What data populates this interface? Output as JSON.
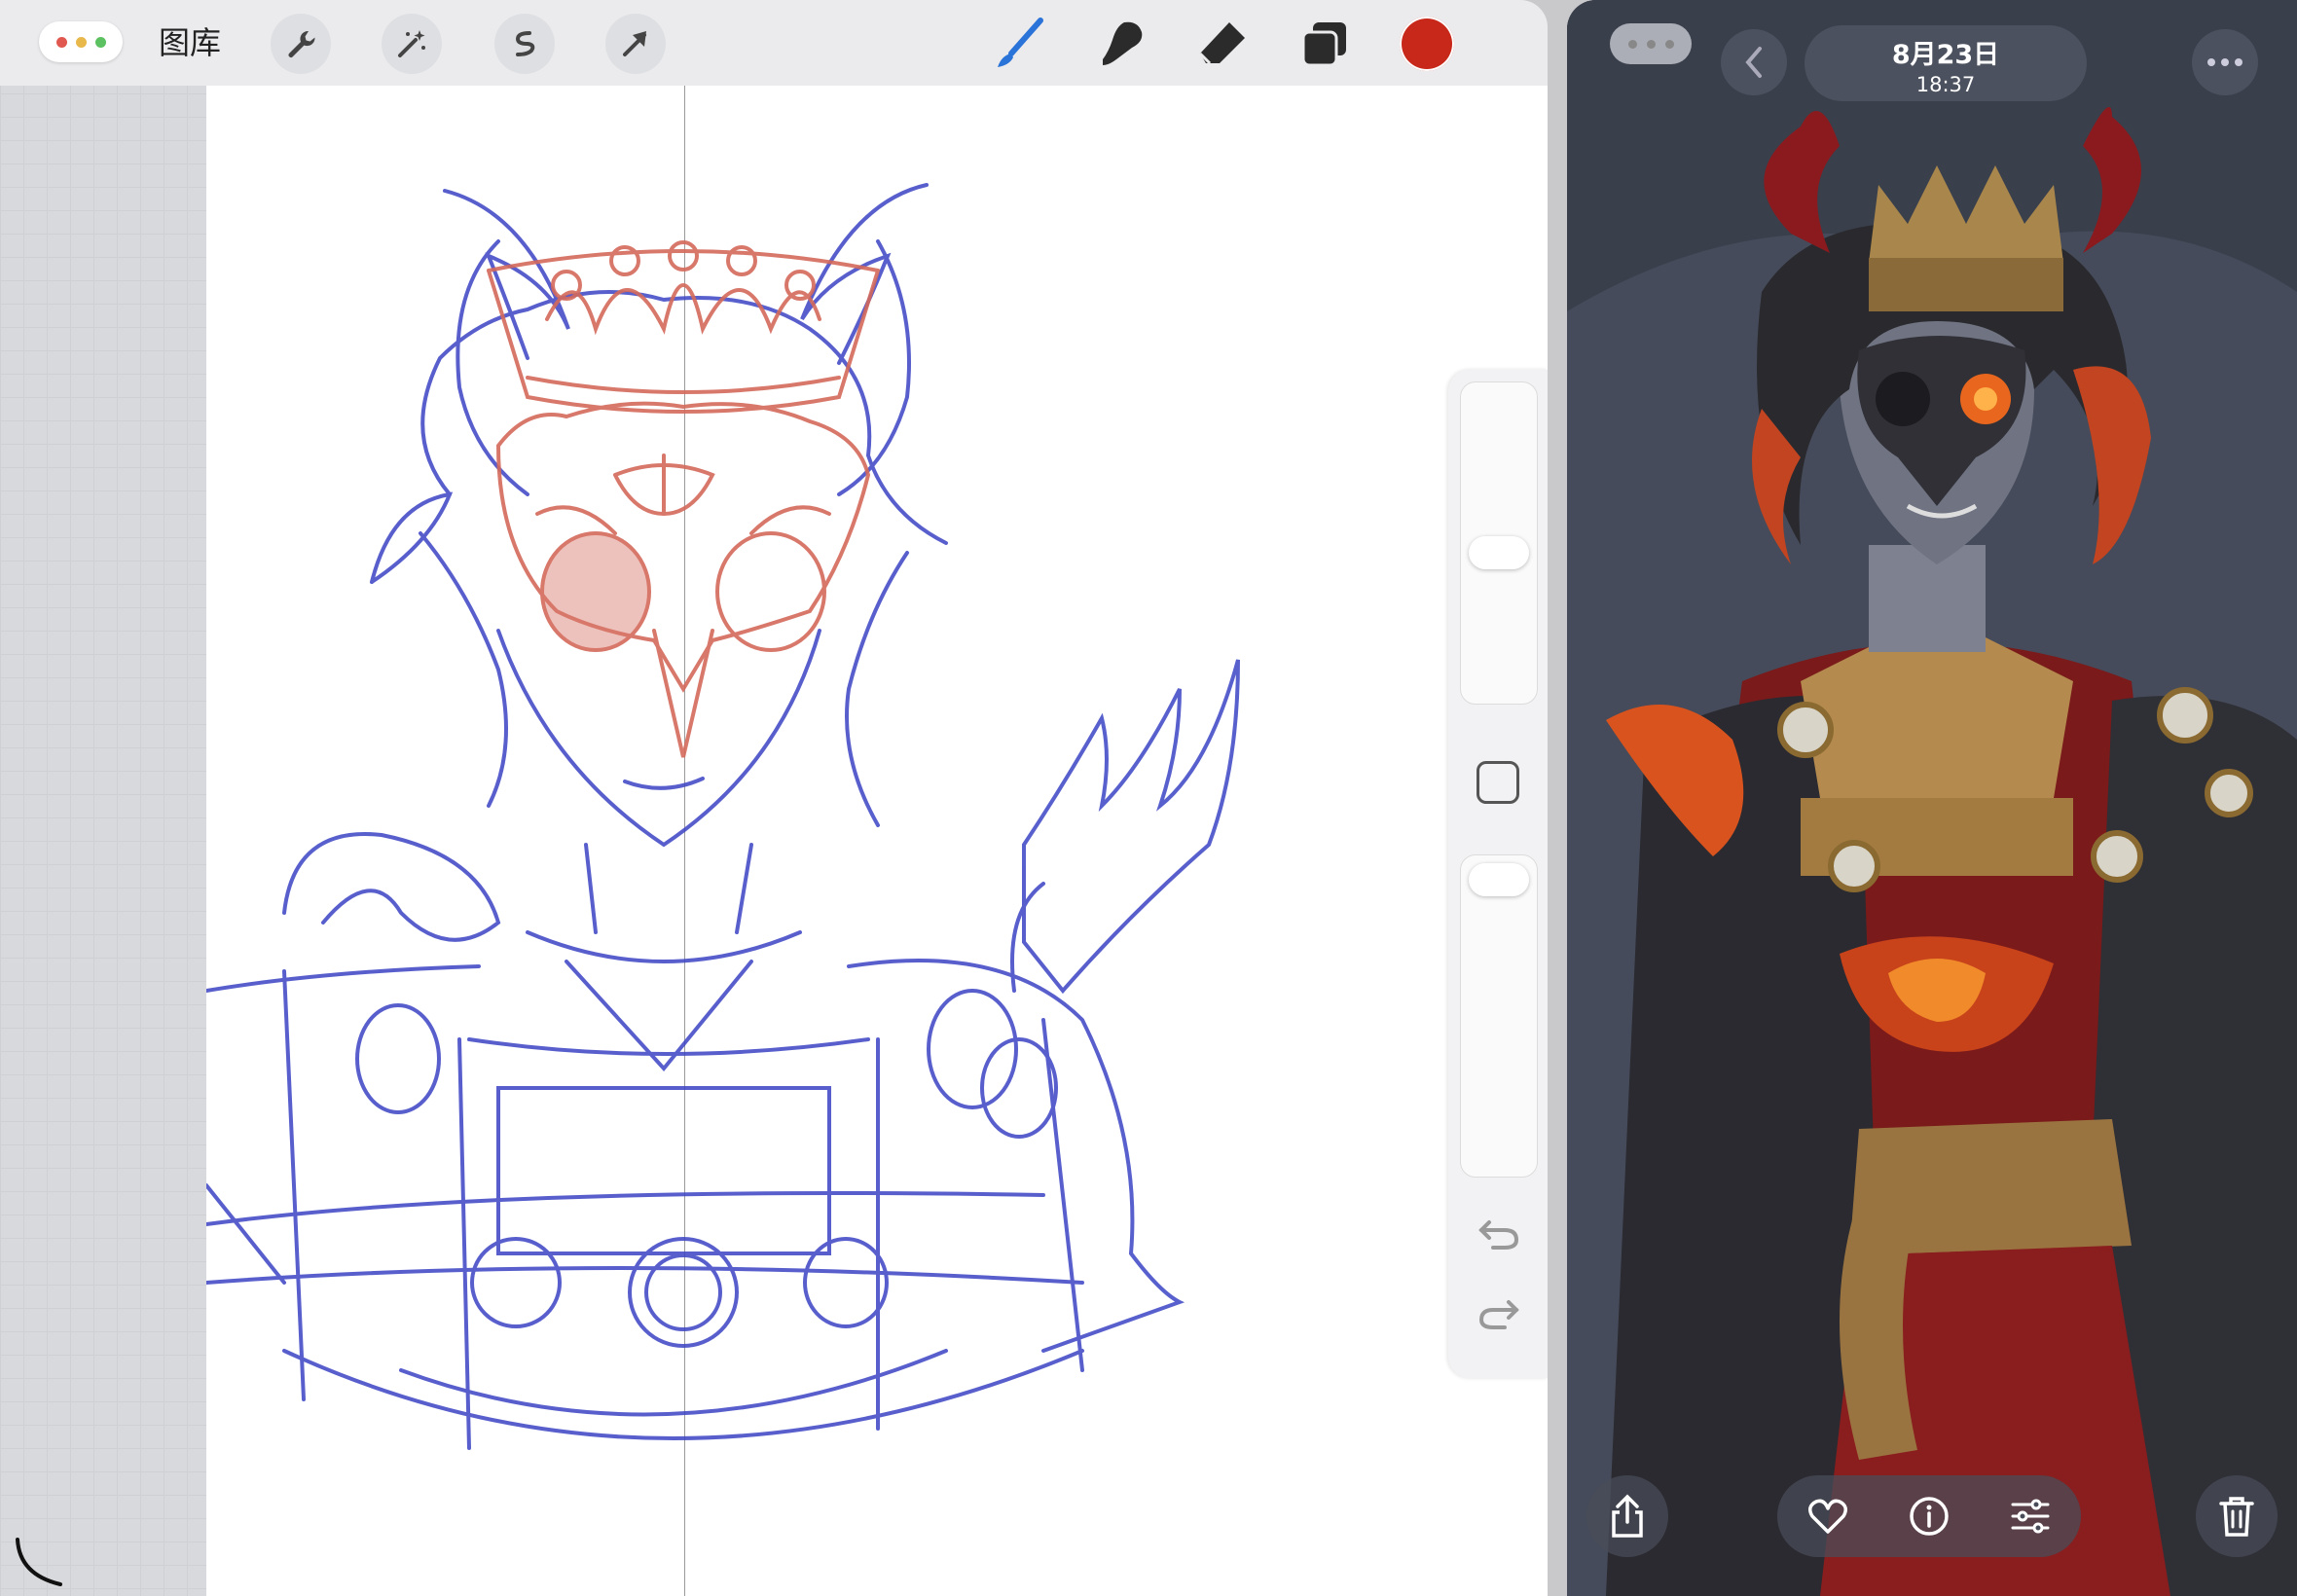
{
  "drawing_app": {
    "gallery_label": "图库",
    "tools_left": [
      {
        "icon": "wrench-icon"
      },
      {
        "icon": "magic-wand-icon"
      },
      {
        "icon": "selection-icon"
      },
      {
        "icon": "transform-arrow-icon"
      }
    ],
    "tools_right": [
      {
        "icon": "brush-icon"
      },
      {
        "icon": "smudge-icon"
      },
      {
        "icon": "eraser-icon"
      },
      {
        "icon": "layers-icon"
      }
    ],
    "current_color": "#c8281a",
    "sidebar": {
      "undo_icon": "undo-icon",
      "redo_icon": "redo-icon"
    }
  },
  "photo_viewer": {
    "date": "8月23日",
    "time": "18:37",
    "bottom_icons": [
      "share-icon",
      "heart-icon",
      "info-icon",
      "adjust-icon",
      "trash-icon"
    ]
  }
}
